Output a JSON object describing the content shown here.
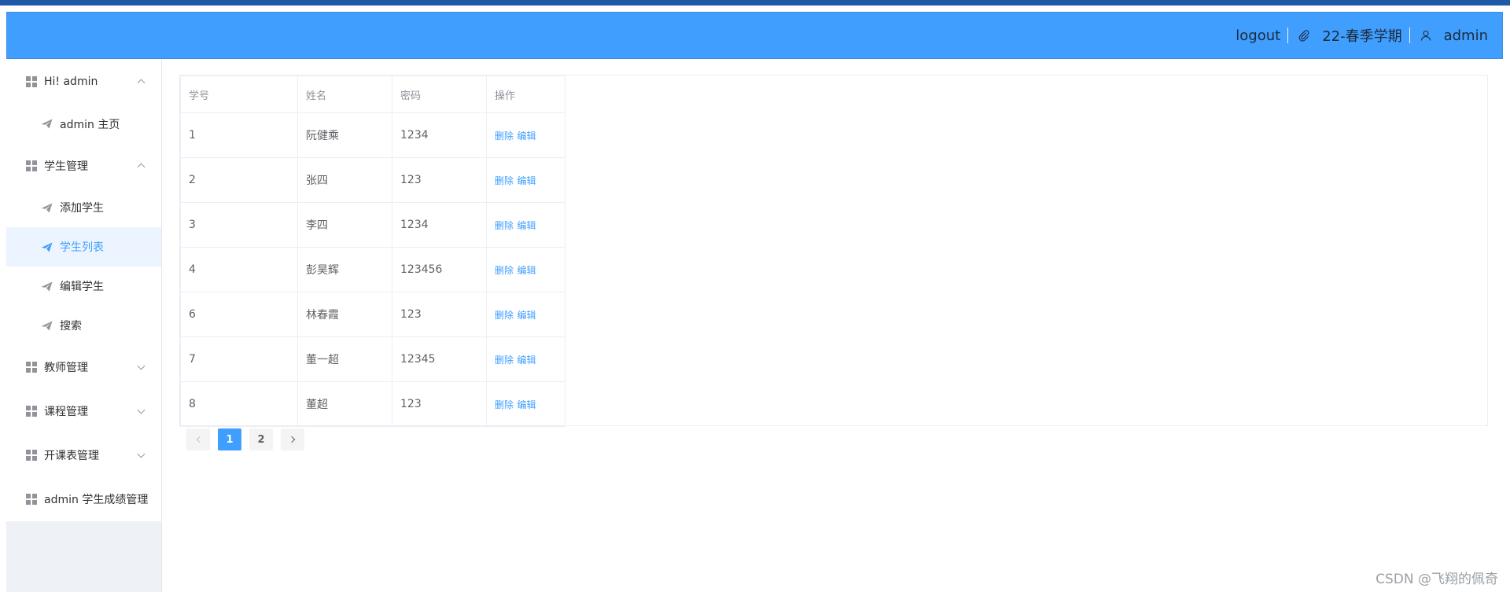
{
  "header": {
    "logout_label": "logout",
    "semester_label": "22-春季学期",
    "user_label": "admin",
    "bg_color": "#409eff"
  },
  "sidebar": {
    "groups": [
      {
        "title": "Hi! admin",
        "expanded": true,
        "items": [
          {
            "label": "admin 主页"
          }
        ]
      },
      {
        "title": "学生管理",
        "expanded": true,
        "items": [
          {
            "label": "添加学生"
          },
          {
            "label": "学生列表",
            "active": true
          },
          {
            "label": "编辑学生"
          },
          {
            "label": "搜索"
          }
        ]
      },
      {
        "title": "教师管理",
        "expanded": false
      },
      {
        "title": "课程管理",
        "expanded": false
      },
      {
        "title": "开课表管理",
        "expanded": false
      },
      {
        "title": "admin 学生成绩管理",
        "expanded": false
      }
    ]
  },
  "table": {
    "headers": [
      "学号",
      "姓名",
      "密码",
      "操作"
    ],
    "delete_label": "删除",
    "edit_label": "编辑",
    "rows": [
      {
        "id": "1",
        "name": "阮健乘",
        "password": "1234"
      },
      {
        "id": "2",
        "name": "张四",
        "password": "123"
      },
      {
        "id": "3",
        "name": "李四",
        "password": "1234"
      },
      {
        "id": "4",
        "name": "彭昊辉",
        "password": "123456"
      },
      {
        "id": "6",
        "name": "林春霞",
        "password": "123"
      },
      {
        "id": "7",
        "name": "董一超",
        "password": "12345"
      },
      {
        "id": "8",
        "name": "董超",
        "password": "123"
      }
    ]
  },
  "pagination": {
    "pages": [
      "1",
      "2"
    ],
    "current": "1"
  },
  "watermark": "CSDN @飞翔的佩奇",
  "colors": {
    "accent": "#409eff",
    "active_bg": "#ecf5ff",
    "top_strip": "#1f5aa8"
  }
}
